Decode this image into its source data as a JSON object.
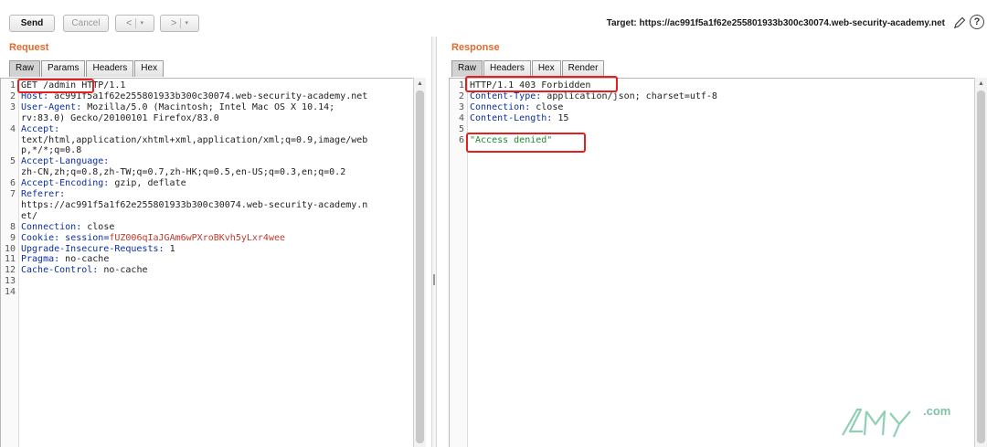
{
  "toolbar": {
    "send_label": "Send",
    "cancel_label": "Cancel",
    "back_label": "<",
    "forward_label": ">",
    "dropdown_glyph": "▾",
    "target_label": "Target: https://ac991f5a1f62e255801933b300c30074.web-security-academy.net"
  },
  "request": {
    "title": "Request",
    "tabs": [
      "Raw",
      "Params",
      "Headers",
      "Hex"
    ],
    "active_tab": "Raw",
    "lines": [
      {
        "n": "1",
        "code": "GET /admin HTTP/1.1"
      },
      {
        "n": "2",
        "code": "Host: ac991f5a1f62e255801933b300c30074.web-security-academy.net"
      },
      {
        "n": "3",
        "code": "User-Agent: Mozilla/5.0 (Macintosh; Intel Mac OS X 10.14;"
      },
      {
        "n": "",
        "code": "rv:83.0) Gecko/20100101 Firefox/83.0"
      },
      {
        "n": "4",
        "code": "Accept:"
      },
      {
        "n": "",
        "code": "text/html,application/xhtml+xml,application/xml;q=0.9,image/web"
      },
      {
        "n": "",
        "code": "p,*/*;q=0.8"
      },
      {
        "n": "5",
        "code": "Accept-Language:"
      },
      {
        "n": "",
        "code": "zh-CN,zh;q=0.8,zh-TW;q=0.7,zh-HK;q=0.5,en-US;q=0.3,en;q=0.2"
      },
      {
        "n": "6",
        "code": "Accept-Encoding: gzip, deflate"
      },
      {
        "n": "7",
        "code": "Referer:"
      },
      {
        "n": "",
        "code": "https://ac991f5a1f62e255801933b300c30074.web-security-academy.n"
      },
      {
        "n": "",
        "code": "et/"
      },
      {
        "n": "8",
        "code": "Connection: close"
      },
      {
        "n": "9",
        "code": "Cookie: session=fUZ006qIaJGAm6wPXroBKvh5yLxr4wee"
      },
      {
        "n": "10",
        "code": "Upgrade-Insecure-Requests: 1"
      },
      {
        "n": "11",
        "code": "Pragma: no-cache"
      },
      {
        "n": "12",
        "code": "Cache-Control: no-cache"
      },
      {
        "n": "13",
        "code": ""
      },
      {
        "n": "14",
        "code": ""
      }
    ]
  },
  "response": {
    "title": "Response",
    "tabs": [
      "Raw",
      "Headers",
      "Hex",
      "Render"
    ],
    "active_tab": "Raw",
    "lines": [
      {
        "n": "1",
        "code": "HTTP/1.1 403 Forbidden"
      },
      {
        "n": "2",
        "code": "Content-Type: application/json; charset=utf-8"
      },
      {
        "n": "3",
        "code": "Connection: close"
      },
      {
        "n": "4",
        "code": "Content-Length: 15"
      },
      {
        "n": "5",
        "code": ""
      },
      {
        "n": "6",
        "code": "\"Access denied\""
      }
    ]
  },
  "watermark": {
    "suffix": ".com"
  },
  "colors": {
    "accent_title": "#e06a2b",
    "header_name": "#0b2fa3",
    "cookie_value": "#c0392b",
    "string_value": "#1f8a2e",
    "annotation": "#e32020"
  }
}
